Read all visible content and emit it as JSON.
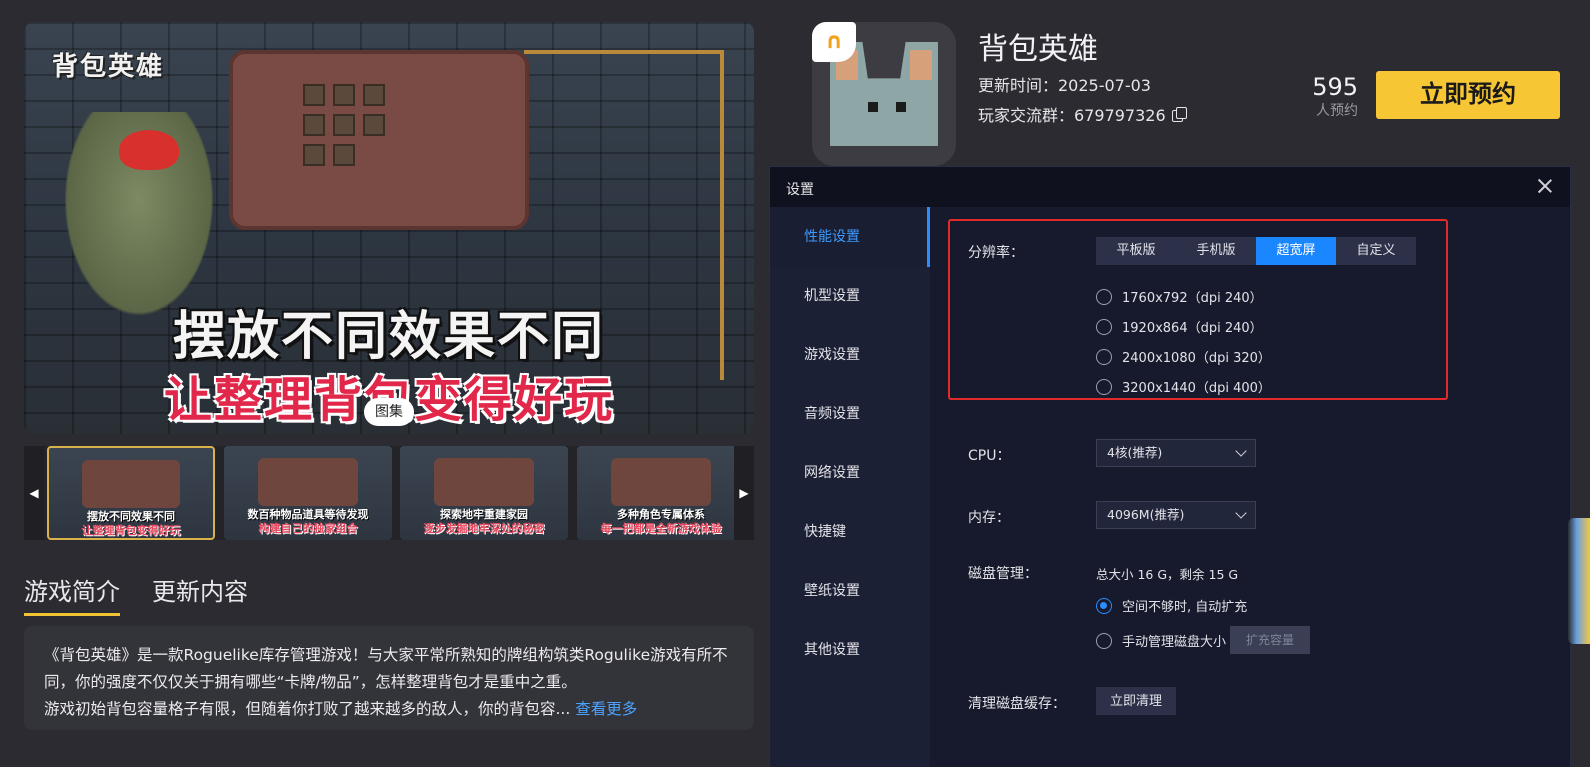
{
  "hero": {
    "logo": "背包英雄",
    "caption_line1": "摆放不同效果不同",
    "caption_line2": "让整理背包变得好玩",
    "gallery_label": "图集"
  },
  "thumbnails": [
    {
      "line1": "摆放不同效果不同",
      "line2": "让整理背包变得好玩"
    },
    {
      "line1": "数百种物品道具等待发现",
      "line2": "构建自己的独家组合"
    },
    {
      "line1": "探索地牢重建家园",
      "line2": "逐步发掘地牢深处的秘密"
    },
    {
      "line1": "多种角色专属体系",
      "line2": "每一把都是全新游戏体验"
    }
  ],
  "tabs": [
    "游戏简介",
    "更新内容"
  ],
  "description": {
    "line1": "《背包英雄》是一款Roguelike库存管理游戏！与大家平常所熟知的牌组构筑类Rogulike游戏有所不",
    "line2": "同，你的强度不仅仅关于拥有哪些“卡牌/物品”，怎样整理背包才是重中之重。",
    "line3": "游戏初始背包容量格子有限，但随着你打败了越来越多的敌人，你的背包容...",
    "more": "查看更多"
  },
  "game": {
    "title": "背包英雄",
    "update_time": "更新时间：2025-07-03",
    "group": "玩家交流群：679797326",
    "reserve_count": "595",
    "reserve_label": "人预约",
    "reserve_button": "立即预约"
  },
  "settings": {
    "title": "设置",
    "nav": [
      "性能设置",
      "机型设置",
      "游戏设置",
      "音频设置",
      "网络设置",
      "快捷键",
      "壁纸设置",
      "其他设置"
    ],
    "resolution_label": "分辨率：",
    "resolution_tabs": [
      "平板版",
      "手机版",
      "超宽屏",
      "自定义"
    ],
    "resolution_options": [
      "1760x792（dpi 240）",
      "1920x864（dpi 240）",
      "2400x1080（dpi 320）",
      "3200x1440（dpi 400）"
    ],
    "cpu_label": "CPU：",
    "cpu_value": "4核(推荐)",
    "memory_label": "内存：",
    "memory_value": "4096M(推荐)",
    "disk_label": "磁盘管理：",
    "disk_info": "总大小 16 G，剩余 15 G",
    "disk_auto": "空间不够时, 自动扩充",
    "disk_manual": "手动管理磁盘大小",
    "disk_expand": "扩充容量",
    "cache_label": "清理磁盘缓存：",
    "cache_button": "立即清理"
  },
  "colors": {
    "accent": "#2a8cff",
    "reserve": "#f6c634",
    "highlight_box": "#e22a2a"
  }
}
